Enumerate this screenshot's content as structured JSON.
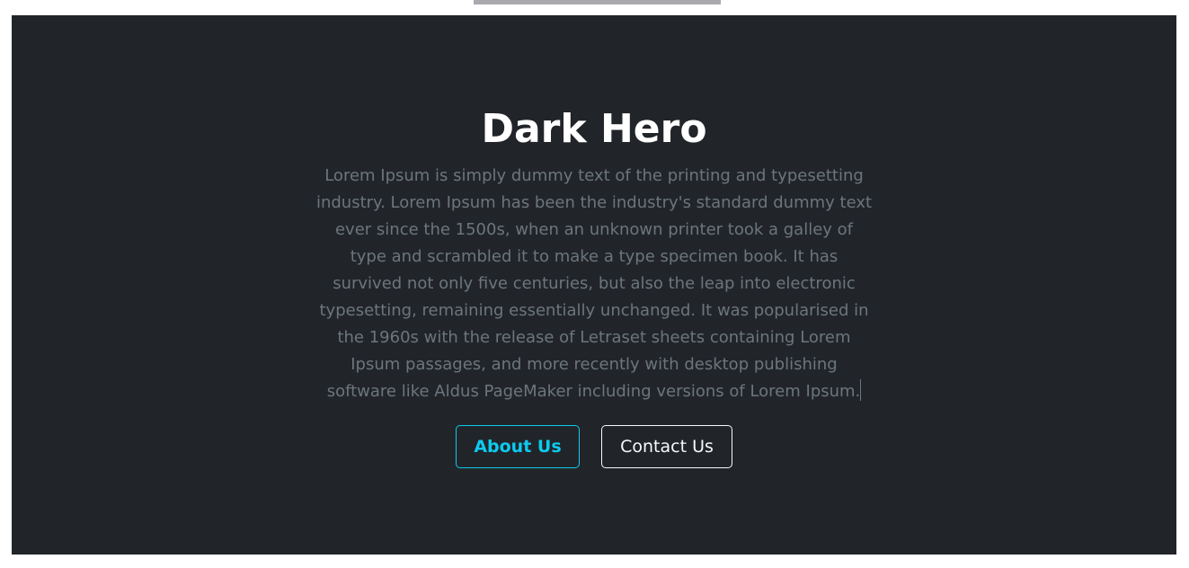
{
  "hero": {
    "title": "Dark Hero",
    "description": "Lorem Ipsum is simply dummy text of the printing and typesetting industry. Lorem Ipsum has been the industry's standard dummy text ever since the 1500s, when an unknown printer took a galley of type and scrambled it to make a type specimen book. It has survived not only five centuries, but also the leap into electronic typesetting, remaining essentially unchanged. It was popularised in the 1960s with the release of Letraset sheets containing Lorem Ipsum passages, and more recently with desktop publishing software like Aldus PageMaker including versions of Lorem Ipsum.",
    "buttons": {
      "about_label": "About Us",
      "contact_label": "Contact Us"
    }
  },
  "colors": {
    "hero_background": "#212529",
    "title": "#ffffff",
    "body_text": "#6c757d",
    "about_accent": "#0dcaf0",
    "contact_outline": "#f8f9fa",
    "top_tab": "#a9a9ae"
  }
}
